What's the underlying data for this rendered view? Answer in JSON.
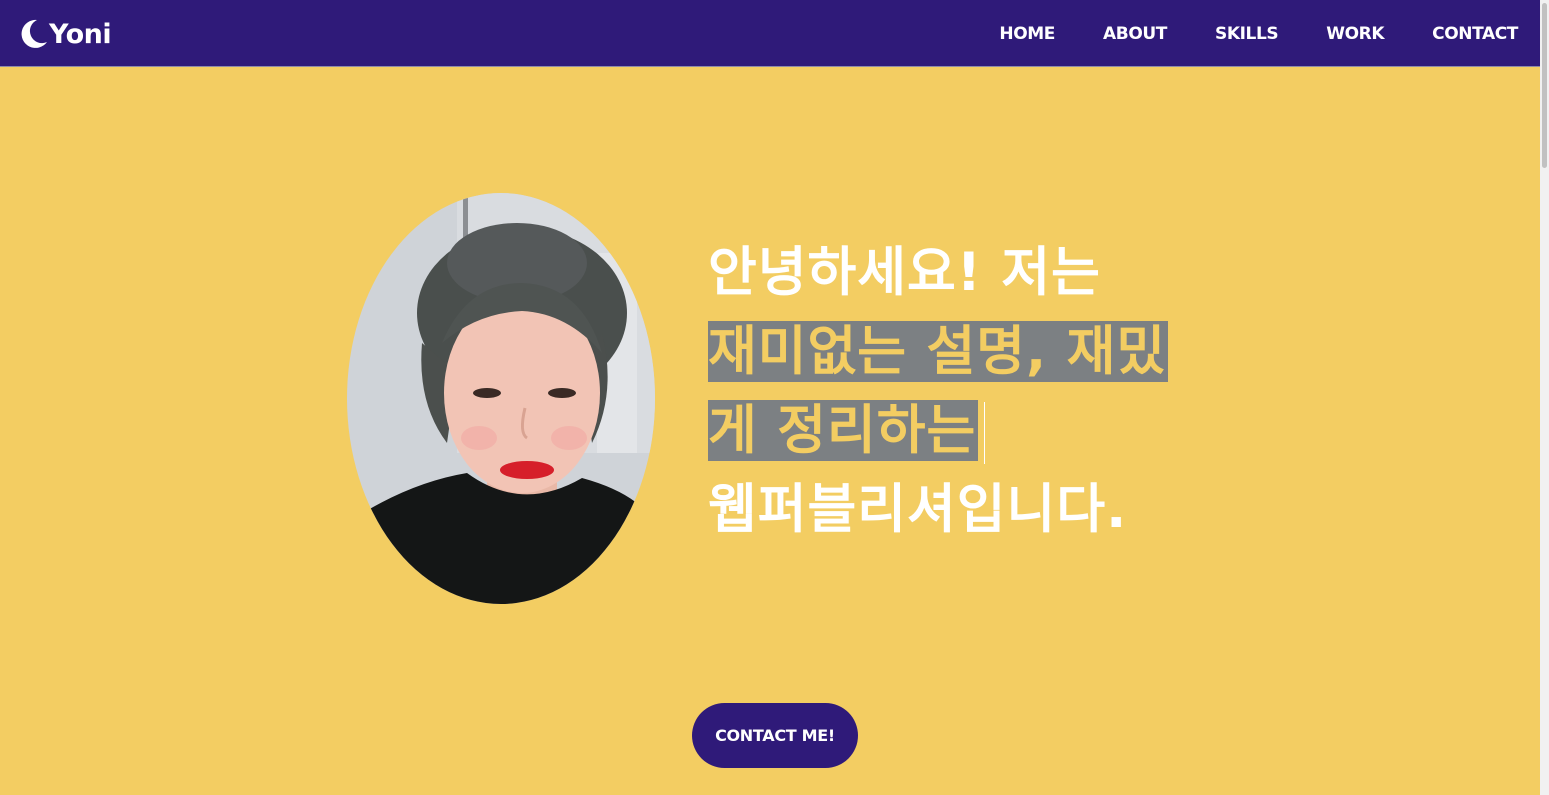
{
  "header": {
    "logo_text": "Yoni",
    "logo_icon": "moon-icon",
    "nav": [
      "HOME",
      "ABOUT",
      "SKILLS",
      "WORK",
      "CONTACT"
    ]
  },
  "hero": {
    "photo_alt": "profile photo",
    "line1": "안녕하세요! 저는",
    "line2": "재미없는 설명, 재밌",
    "line3": "게 정리하는",
    "line4": "웹퍼블리셔입니다.",
    "cta_label": "CONTACT ME!"
  },
  "colors": {
    "navbar": "#2f1a79",
    "background": "#f3cd62",
    "highlight": "#7c8083",
    "button": "#2f1a79"
  }
}
